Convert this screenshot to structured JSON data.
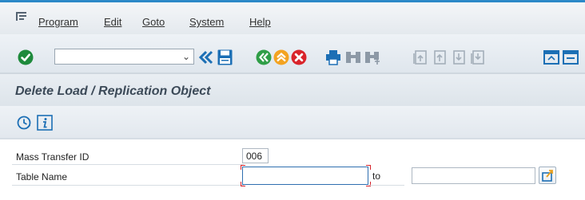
{
  "menu": {
    "items": [
      {
        "label": "Program"
      },
      {
        "label": "Edit"
      },
      {
        "label": "Goto"
      },
      {
        "label": "System"
      },
      {
        "label": "Help"
      }
    ]
  },
  "toolbar": {
    "command_field_value": "",
    "icons": [
      "enter-icon",
      "command-dropdown-icon",
      "back-icon",
      "save-icon",
      "back-green-icon",
      "exit-icon",
      "cancel-icon",
      "print-icon",
      "find-icon",
      "find-next-icon",
      "first-page-icon",
      "previous-page-icon",
      "next-page-icon",
      "last-page-icon",
      "create-session-icon",
      "shortcut-icon"
    ]
  },
  "title": "Delete Load / Replication Object",
  "app_toolbar": {
    "icons": [
      "execute-icon",
      "info-icon"
    ]
  },
  "form": {
    "mass_transfer_label": "Mass Transfer ID",
    "mass_transfer_value": "006",
    "table_name_label": "Table Name",
    "table_name_from": "",
    "to_label": "to",
    "table_name_to": ""
  },
  "colors": {
    "accent": "#2c89c8",
    "enter_green": "#1e8a3c",
    "nav_blue": "#1c6fb5",
    "cancel_red": "#d9242b",
    "exit_orange": "#f3a321",
    "title_text": "#3c4a58"
  }
}
